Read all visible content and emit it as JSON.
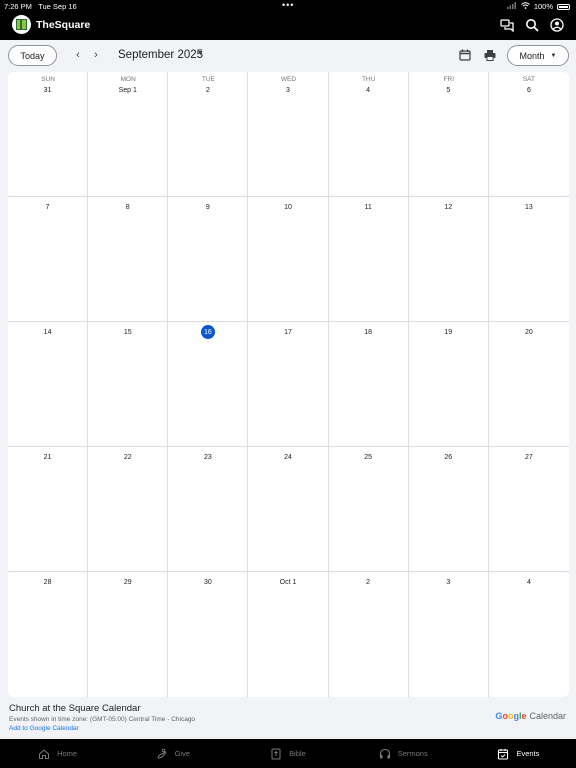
{
  "status_bar": {
    "time": "7:26 PM",
    "date": "Tue Sep 16",
    "battery": "100%"
  },
  "app": {
    "title": "TheSquare"
  },
  "toolbar": {
    "today_label": "Today",
    "month_label": "September 2025",
    "view_label": "Month"
  },
  "calendar": {
    "weekdays": [
      "SUN",
      "MON",
      "TUE",
      "WED",
      "THU",
      "FRI",
      "SAT"
    ],
    "today_index": 16,
    "days": [
      "31",
      "Sep 1",
      "2",
      "3",
      "4",
      "5",
      "6",
      "7",
      "8",
      "9",
      "10",
      "11",
      "12",
      "13",
      "14",
      "15",
      "16",
      "17",
      "18",
      "19",
      "20",
      "21",
      "22",
      "23",
      "24",
      "25",
      "26",
      "27",
      "28",
      "29",
      "30",
      "Oct 1",
      "2",
      "3",
      "4"
    ]
  },
  "footer": {
    "calendar_name": "Church at the Square Calendar",
    "timezone": "Events shown in time zone: (GMT-05:00) Central Time - Chicago",
    "add_link": "Add to Google Calendar",
    "brand_google": "Google",
    "brand_calendar": "Calendar"
  },
  "tabs": [
    {
      "label": "Home",
      "icon": "home-icon"
    },
    {
      "label": "Give",
      "icon": "give-icon"
    },
    {
      "label": "Bible",
      "icon": "bible-icon"
    },
    {
      "label": "Sermons",
      "icon": "headphones-icon"
    },
    {
      "label": "Events",
      "icon": "calendar-icon",
      "active": true
    }
  ],
  "colors": {
    "accent": "#0b57d0",
    "link": "#1a73e8"
  }
}
